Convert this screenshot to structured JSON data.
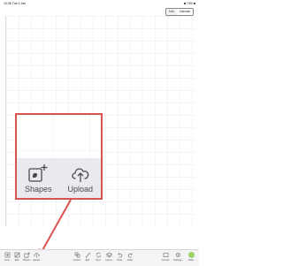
{
  "status_bar": {
    "time": "10:35",
    "date": "Tue 3 Jan",
    "battery": "■ 74% ■"
  },
  "mode_toggle": {
    "options": [
      "Mat",
      "Canvas"
    ],
    "active": "Canvas"
  },
  "callout": {
    "tools": [
      {
        "label": "Shapes",
        "icon": "shapes-icon"
      },
      {
        "label": "Upload",
        "icon": "upload-cloud-icon"
      }
    ]
  },
  "bottom_bar": {
    "left_items": [
      {
        "label": "New",
        "icon": "new-icon"
      },
      {
        "label": "Edit",
        "icon": "edit-icon"
      },
      {
        "label": "Shapes",
        "icon": "shapes-icon"
      },
      {
        "label": "Upload",
        "icon": "upload-icon"
      }
    ],
    "center_items": [
      {
        "label": "Actions",
        "icon": "actions-icon"
      },
      {
        "label": "Edit",
        "icon": "edit-icon"
      },
      {
        "label": "Sync",
        "icon": "sync-icon"
      },
      {
        "label": "Layers",
        "icon": "layers-icon"
      },
      {
        "label": "Undo",
        "icon": "undo-icon"
      },
      {
        "label": "Redo",
        "icon": "redo-icon"
      }
    ],
    "right_items": [
      {
        "label": "Canvas",
        "icon": "canvas-icon"
      },
      {
        "label": "Settings",
        "icon": "settings-icon"
      },
      {
        "label": "Make",
        "icon": "make-icon"
      }
    ]
  },
  "colors": {
    "highlight": "#d9534f",
    "make_button": "#9bd36a"
  }
}
